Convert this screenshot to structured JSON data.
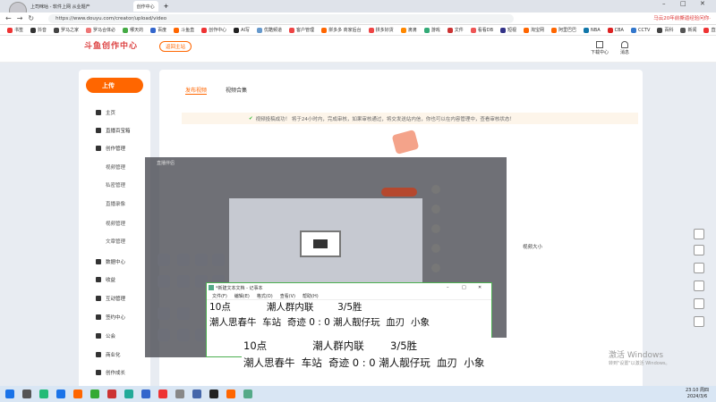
{
  "browser": {
    "tabs": [
      "上司咪咕 - 软件上网 从业题产",
      "",
      "创作中心"
    ],
    "url": "https://www.douyu.com/creator/upload/video",
    "ad_text": "马云20年前撕逼经验问你·"
  },
  "bookmarks": [
    "书签",
    "抖音",
    "罗马之家",
    "罗马合体必",
    "哪天的",
    "百度",
    "斗鱼直",
    "创作中心",
    "AI写",
    "优酷频道",
    "客户管理",
    "拼多多 商家后台",
    "拼多好货",
    "滴滴",
    "游戏",
    "文件",
    "看看DB",
    "短视",
    "淘宝网",
    "阿里巴巴",
    "NBA",
    "CBA",
    "CCTV",
    "百科",
    "新闻",
    "直播",
    "CBA"
  ],
  "header": {
    "logo": "斗鱼创作中心",
    "return_btn": "返回主站",
    "right_items": [
      "下载中心",
      "消息"
    ]
  },
  "sidebar": {
    "upload": "上传",
    "items": [
      {
        "label": "主页",
        "type": "main"
      },
      {
        "label": "直播百宝箱",
        "type": "main"
      },
      {
        "label": "创作管理",
        "type": "main"
      },
      {
        "label": "视频管理",
        "type": "sub"
      },
      {
        "label": "私密管理",
        "type": "sub"
      },
      {
        "label": "直播录像",
        "type": "sub"
      },
      {
        "label": "视频管理",
        "type": "sub"
      },
      {
        "label": "文章管理",
        "type": "sub"
      },
      {
        "label": "数据中心",
        "type": "main"
      },
      {
        "label": "收益",
        "type": "main"
      },
      {
        "label": "互动管理",
        "type": "main"
      },
      {
        "label": "签约中心",
        "type": "main"
      },
      {
        "label": "公会",
        "type": "main"
      },
      {
        "label": "商业化",
        "type": "main"
      },
      {
        "label": "创作成长",
        "type": "main"
      }
    ]
  },
  "content": {
    "tabs": [
      "发布视频",
      "视频合集"
    ],
    "success_msg": "视频投稿成功！ 将于24小时内，完成审核，如果审核通过，将交发送站内信，你也可以在内容管理中，查看审核状态！",
    "file_size_label": "视频大小"
  },
  "dark_app": {
    "title": "直播伴侣"
  },
  "notepad_small": {
    "title": "*新建文本文档 - 记事本",
    "menu": [
      "文件(F)",
      "编辑(E)",
      "格式(O)",
      "查看(V)",
      "帮助(H)"
    ],
    "line1": "10点            潮人群内联        3/5胜",
    "line2": "潮人思春牛  车站  奇迹 0 : 0 潮人靓仔玩  血刃  小象"
  },
  "notepad_big": {
    "line1": "10点              潮人群内联        3/5胜",
    "line2": "潮人思春牛  车站  奇迹 0 : 0 潮人靓仔玩  血刃  小象"
  },
  "watermark": {
    "line1": "激活 Windows",
    "line2": "转到\"设置\"以激活 Windows。"
  },
  "tray": {
    "time": "23:10 周四",
    "date": "2024/3/6"
  },
  "colors": {
    "accent": "#ff6600",
    "taskbar": "#d9e6f4"
  }
}
